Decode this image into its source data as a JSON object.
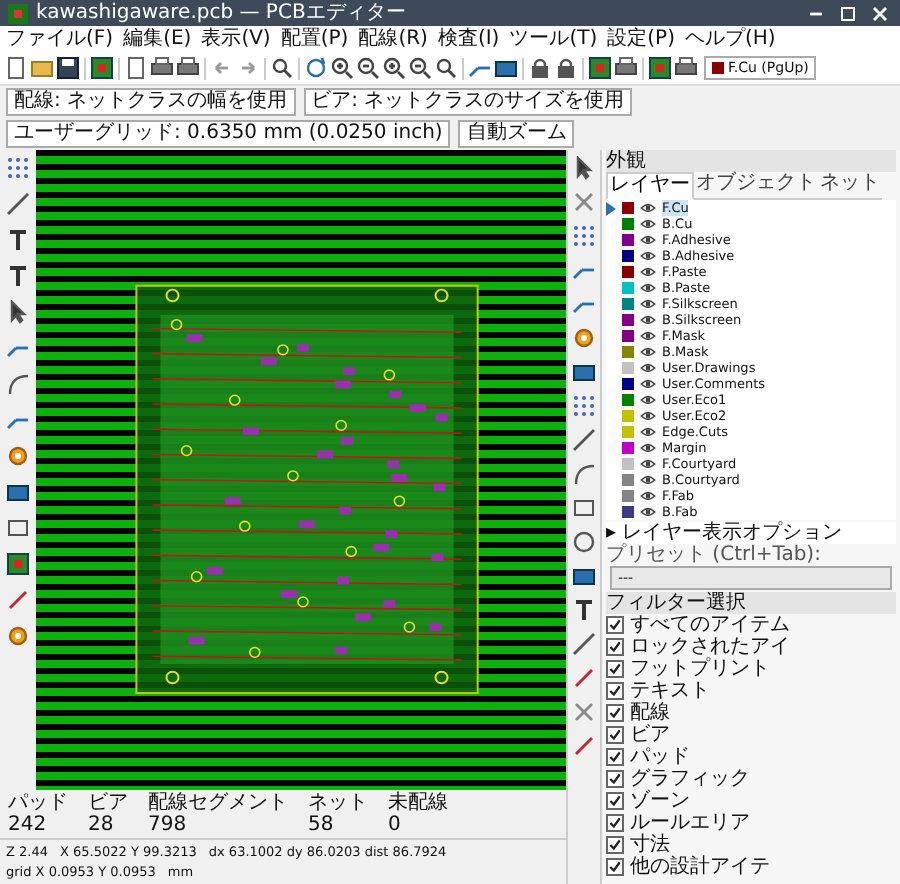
{
  "window": {
    "title": "kawashigaware.pcb — PCBエディター"
  },
  "menu": [
    "ファイル(F)",
    "編集(E)",
    "表示(V)",
    "配置(P)",
    "配線(R)",
    "検査(I)",
    "ツール(T)",
    "設定(P)",
    "ヘルプ(H)"
  ],
  "layer_selector": {
    "value": "F.Cu (PgUp)"
  },
  "toolbar2": [
    {
      "value": "配線: ネットクラスの幅を使用"
    },
    {
      "value": "ビア: ネットクラスのサイズを使用"
    },
    {
      "value": "ユーザーグリッド: 0.6350 mm (0.0250 inch)"
    },
    {
      "value": "自動ズーム"
    }
  ],
  "appearance": {
    "title": "外観",
    "tabs": [
      {
        "label": "レイヤー",
        "selected": true
      },
      {
        "label": "オブジェクト",
        "selected": false
      },
      {
        "label": "ネット",
        "selected": false
      }
    ],
    "layers": [
      {
        "name": "F.Cu",
        "color": "#8b0000",
        "selected": true
      },
      {
        "name": "B.Cu",
        "color": "#008000",
        "selected": false
      },
      {
        "name": "F.Adhesive",
        "color": "#84008a",
        "selected": false
      },
      {
        "name": "B.Adhesive",
        "color": "#000084",
        "selected": false
      },
      {
        "name": "F.Paste",
        "color": "#840000",
        "selected": false
      },
      {
        "name": "B.Paste",
        "color": "#00c2c2",
        "selected": false
      },
      {
        "name": "F.Silkscreen",
        "color": "#008484",
        "selected": false
      },
      {
        "name": "B.Silkscreen",
        "color": "#840084",
        "selected": false
      },
      {
        "name": "F.Mask",
        "color": "#840084",
        "selected": false
      },
      {
        "name": "B.Mask",
        "color": "#848400",
        "selected": false
      },
      {
        "name": "User.Drawings",
        "color": "#c2c2c2",
        "selected": false
      },
      {
        "name": "User.Comments",
        "color": "#000084",
        "selected": false
      },
      {
        "name": "User.Eco1",
        "color": "#008400",
        "selected": false
      },
      {
        "name": "User.Eco2",
        "color": "#c2c200",
        "selected": false
      },
      {
        "name": "Edge.Cuts",
        "color": "#c2c200",
        "selected": false
      },
      {
        "name": "Margin",
        "color": "#c200c2",
        "selected": false
      },
      {
        "name": "F.Courtyard",
        "color": "#c2c2c2",
        "selected": false
      },
      {
        "name": "B.Courtyard",
        "color": "#848484",
        "selected": false
      },
      {
        "name": "F.Fab",
        "color": "#848484",
        "selected": false
      },
      {
        "name": "B.Fab",
        "color": "#3c3c84",
        "selected": false
      }
    ],
    "options_toggle": "▸ レイヤー表示オプション",
    "preset_label": "プリセット (Ctrl+Tab):",
    "preset_value": "---"
  },
  "selection_filter": {
    "title": "フィルター選択",
    "items": [
      {
        "label": "すべてのアイテム",
        "checked": true
      },
      {
        "label": "ロックされたアイ",
        "checked": true
      },
      {
        "label": "フットプリント",
        "checked": true
      },
      {
        "label": "テキスト",
        "checked": true
      },
      {
        "label": "配線",
        "checked": true
      },
      {
        "label": "ビア",
        "checked": true
      },
      {
        "label": "パッド",
        "checked": true
      },
      {
        "label": "グラフィック",
        "checked": true
      },
      {
        "label": "ゾーン",
        "checked": true
      },
      {
        "label": "ルールエリア",
        "checked": true
      },
      {
        "label": "寸法",
        "checked": true
      },
      {
        "label": "他の設計アイテ",
        "checked": true
      }
    ]
  },
  "stats": [
    {
      "label": "パッド",
      "value": "242"
    },
    {
      "label": "ビア",
      "value": "28"
    },
    {
      "label": "配線セグメント",
      "value": "798"
    },
    {
      "label": "ネット",
      "value": "58"
    },
    {
      "label": "未配線",
      "value": "0"
    }
  ],
  "status_bar": [
    "Z 2.44",
    "X 65.5022 Y 99.3213",
    "dx 63.1002 dy 86.0203 dist 86.7924",
    "grid X 0.0953 Y 0.0953",
    "mm"
  ]
}
